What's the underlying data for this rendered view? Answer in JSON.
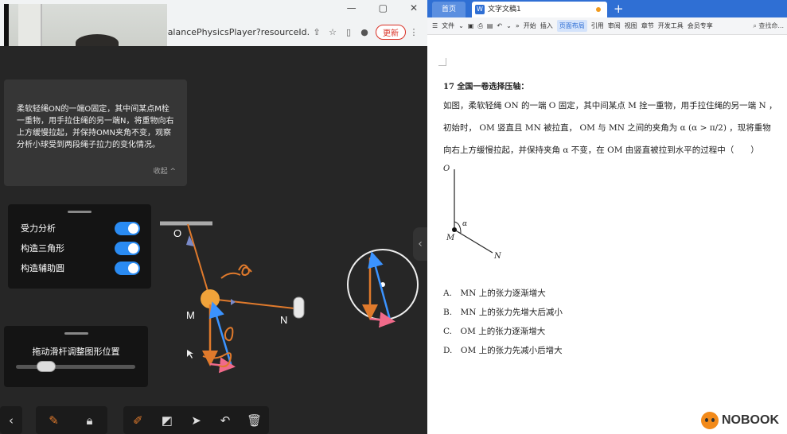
{
  "browser": {
    "url": "/balancePhysicsPlayer?resourceId...",
    "update_label": "更新",
    "window_controls": [
      "—",
      "▢",
      "✕"
    ]
  },
  "sim": {
    "description": "柔软轻绳ON的一端O固定，其中间某点M栓一重物，用手拉住绳的另一端N，将重物向右上方缓慢拉起，并保持OMN夹角不变，观察分析小球受到两段绳子拉力的变化情况。",
    "fold_label": "收起 ^",
    "toggles": [
      {
        "label": "受力分析",
        "on": true
      },
      {
        "label": "构造三角形",
        "on": true
      },
      {
        "label": "构造辅助圆",
        "on": true
      }
    ],
    "slider_label": "拖动滑杆调整图形位置",
    "slider_value": 0.25,
    "point_labels": {
      "O": "O",
      "M": "M",
      "N": "N"
    },
    "colors": {
      "rope": "#e07a2c",
      "tension_om": "#3b93ff",
      "gravity": "#e07a2c",
      "mass": "#f0a33a",
      "toggle_on": "#2a8bf2"
    }
  },
  "toolbar": {
    "left_icons": [
      "back-icon",
      "pen-icon",
      "lock-icon"
    ],
    "right_icons": [
      "brush-icon",
      "eraser-icon",
      "pointer-icon",
      "undo-icon",
      "trash-icon"
    ]
  },
  "doc": {
    "tab_home": "首页",
    "tab_doc": "文字文稿1",
    "tab_plus": "+",
    "ribbon": [
      "文件",
      "开始",
      "插入",
      "页面布局",
      "引用",
      "审阅",
      "视图",
      "章节",
      "开发工具",
      "会员专享"
    ],
    "ribbon_active": "页面布局",
    "ribbon_find": "查找命...",
    "question_title": "17 全国一卷选择压轴：",
    "q_line1": "如图，柔软轻绳 ON 的一端 O 固定，其中间某点 M 拴一重物，用手拉住绳的另一端 N ，",
    "q_line2": "初始时， OM 竖直且 MN 被拉直， OM 与 MN 之间的夹角为 α (α > π/2) ，现将重物",
    "q_line3": "向右上方缓慢拉起，并保持夹角 α 不变，在 OM 由竖直被拉到水平的过程中（　　）",
    "figure_labels": {
      "O": "O",
      "M": "M",
      "N": "N",
      "alpha": "α"
    },
    "options": [
      "A.　MN 上的张力逐渐增大",
      "B.　MN 上的张力先增大后减小",
      "C.　OM 上的张力逐渐增大",
      "D.　OM 上的张力先减小后增大"
    ],
    "brand": "NOBOOK"
  }
}
